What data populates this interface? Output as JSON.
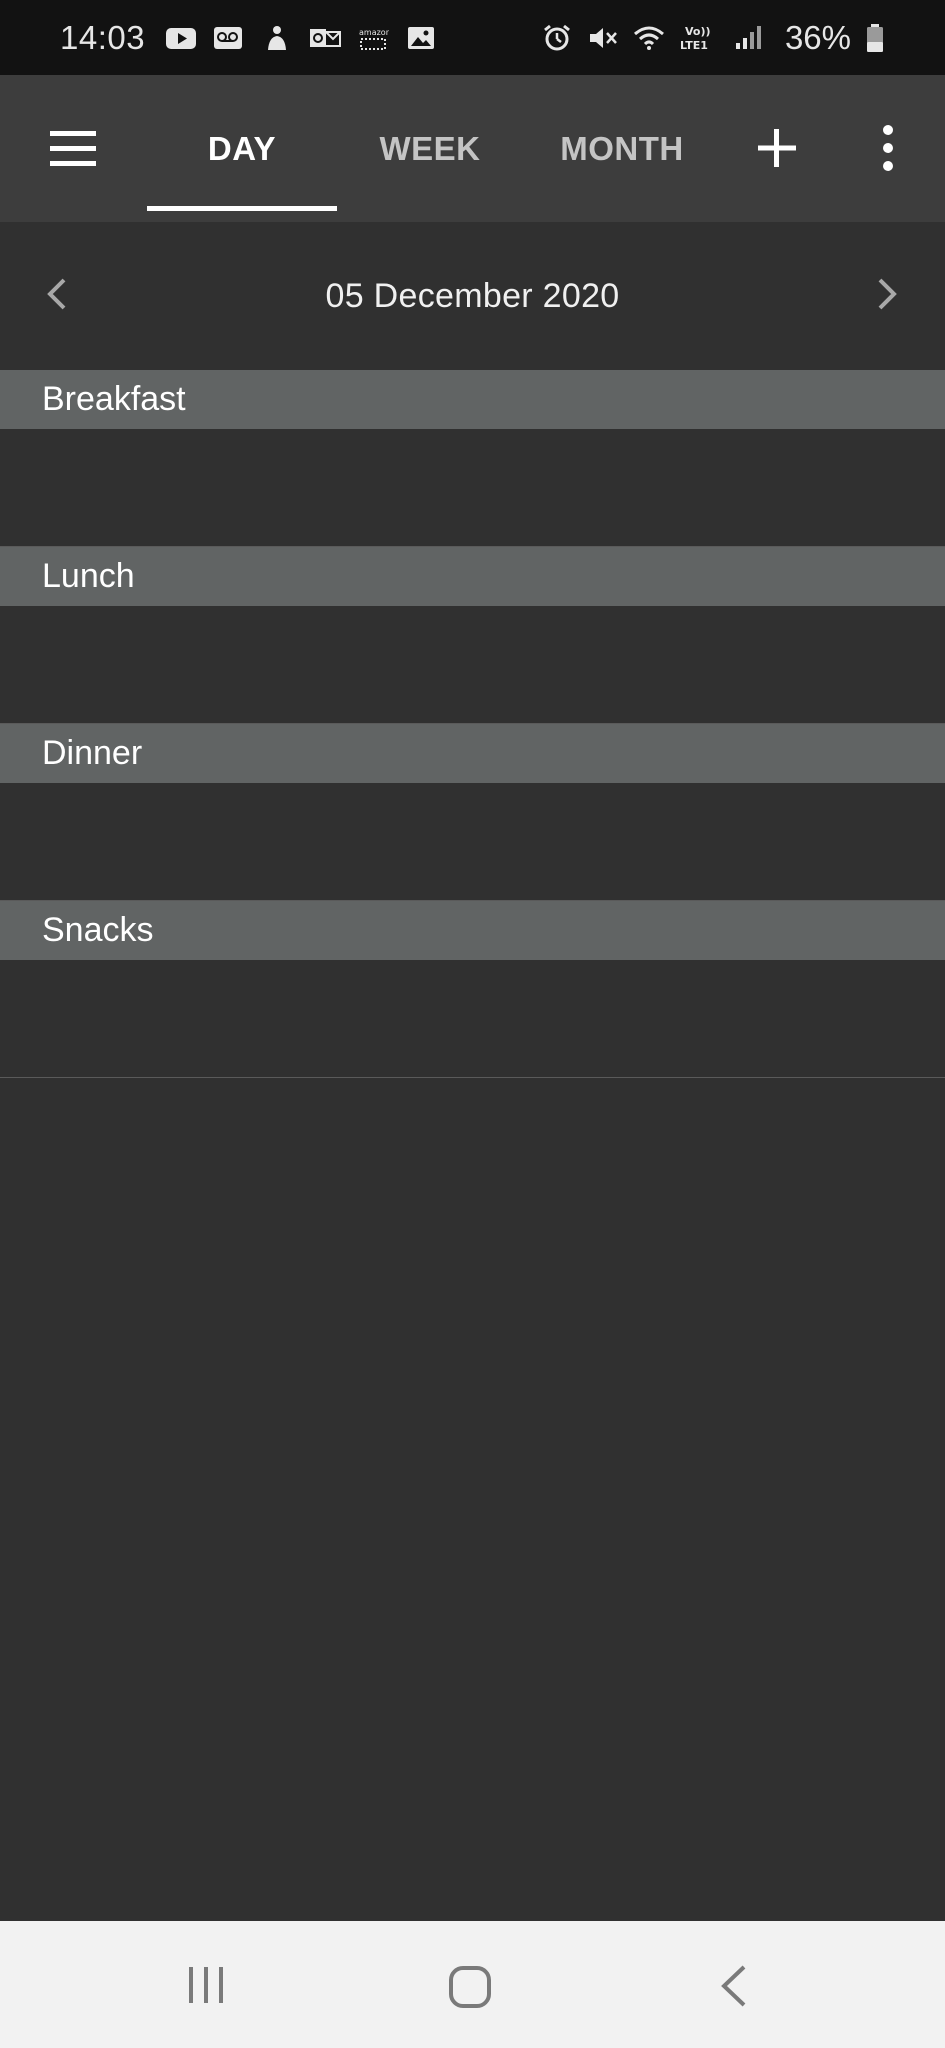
{
  "status_bar": {
    "time": "14:03",
    "battery": "36%",
    "left_icons": [
      "youtube-icon",
      "voicemail-icon",
      "app-notification-icon",
      "outlook-icon",
      "amazon-icon",
      "gallery-icon"
    ],
    "right_icons": [
      "alarm-icon",
      "mute-icon",
      "wifi-icon",
      "volte-icon",
      "signal-icon",
      "battery-icon"
    ]
  },
  "app_bar": {
    "tabs": [
      {
        "label": "DAY",
        "active": true
      },
      {
        "label": "WEEK",
        "active": false
      },
      {
        "label": "MONTH",
        "active": false
      }
    ]
  },
  "date_nav": {
    "date": "05 December 2020"
  },
  "meals": [
    {
      "label": "Breakfast"
    },
    {
      "label": "Lunch"
    },
    {
      "label": "Dinner"
    },
    {
      "label": "Snacks"
    }
  ],
  "colors": {
    "background": "#303030",
    "app_bar": "#3d3d3d",
    "section_header": "#616464",
    "status_bar": "#121212",
    "nav_bar": "#f2f2f2"
  }
}
